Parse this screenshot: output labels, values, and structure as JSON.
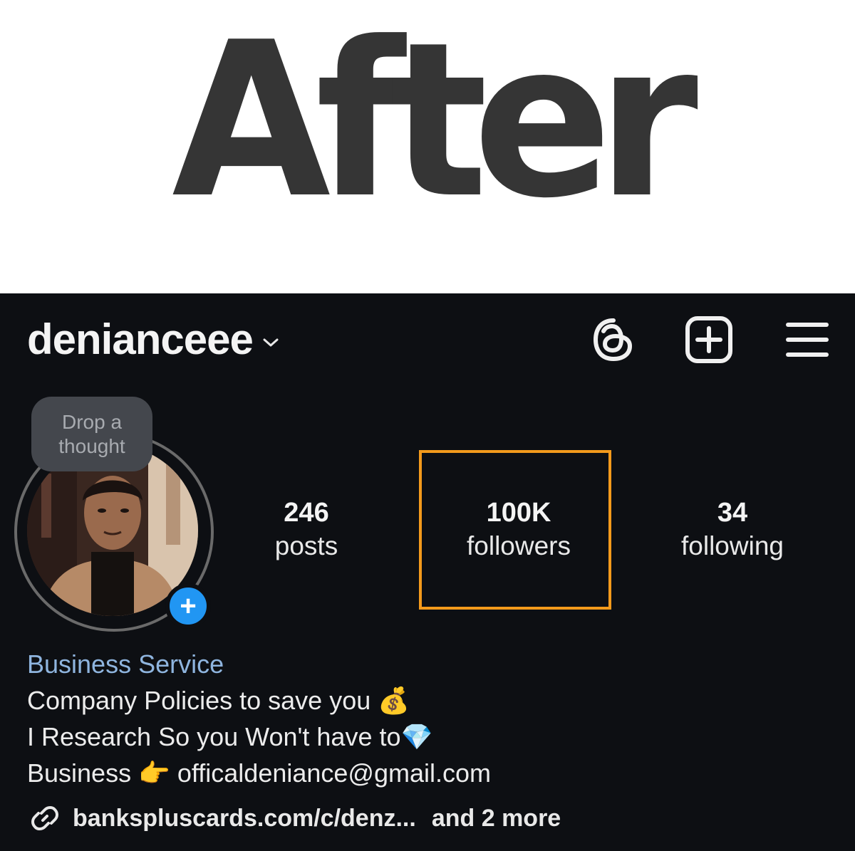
{
  "banner": {
    "title": "After"
  },
  "header": {
    "username": "denianceee"
  },
  "note": {
    "text": "Drop a thought"
  },
  "stats": [
    {
      "value": "246",
      "label": "posts"
    },
    {
      "value": "100K",
      "label": "followers"
    },
    {
      "value": "34",
      "label": "following"
    }
  ],
  "bio": {
    "category": "Business Service",
    "line1": "Company Policies to save you 💰",
    "line2": "I Research So you Won't have to💎",
    "line3": "Business 👉 officaldeniance@gmail.com"
  },
  "link": {
    "url": "bankspluscards.com/c/denz...",
    "more": "and 2 more"
  },
  "colors": {
    "background": "#0d0f13",
    "accent_blue": "#2196f3",
    "highlight_orange": "#f39a1c",
    "category_blue": "#8fb5df"
  },
  "icons": {
    "threads": "threads-icon",
    "create": "add-square-icon",
    "menu": "hamburger-menu-icon",
    "link": "link-icon"
  }
}
